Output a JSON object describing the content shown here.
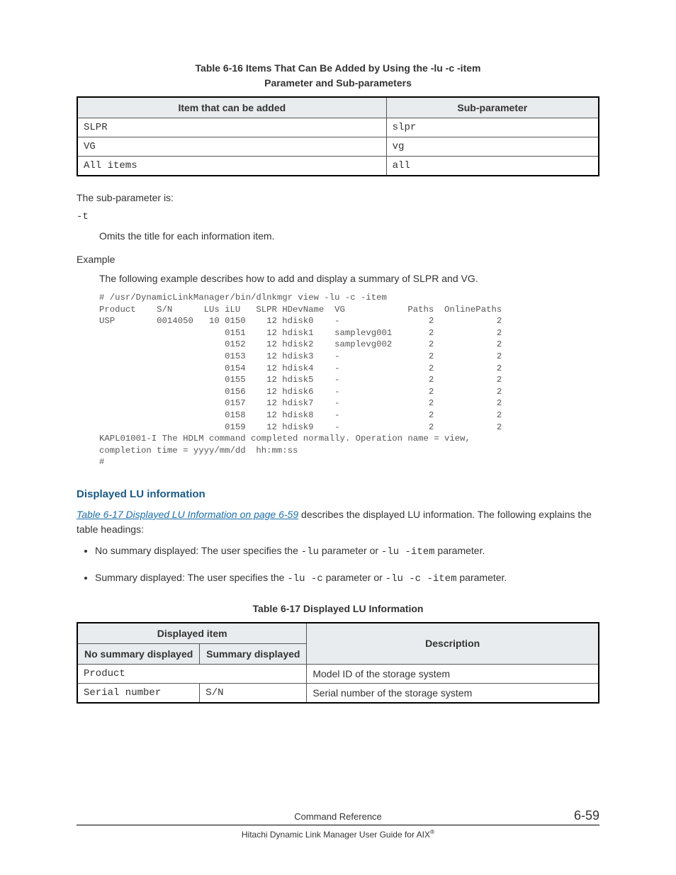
{
  "table616": {
    "caption_line1": "Table 6-16 Items That Can Be Added by Using the -lu -c -item",
    "caption_line2": "Parameter and Sub-parameters",
    "headers": {
      "c1": "Item that can be added",
      "c2": "Sub-parameter"
    },
    "rows": [
      {
        "c1": "SLPR",
        "c2": "slpr"
      },
      {
        "c1": "VG",
        "c2": "vg"
      },
      {
        "c1": "All items",
        "c2": "all"
      }
    ]
  },
  "subparam_intro": "The sub-parameter is:",
  "subparam_flag": "-t",
  "subparam_desc": "Omits the title for each information item.",
  "example": {
    "label": "Example",
    "desc": "The following example describes how to add and display a summary of SLPR and VG.",
    "lines": [
      "# /usr/DynamicLinkManager/bin/dlnkmgr view -lu -c -item",
      "Product    S/N      LUs iLU   SLPR HDevName  VG            Paths  OnlinePaths",
      "USP        0014050   10 0150    12 hdisk0    -                 2            2",
      "                        0151    12 hdisk1    samplevg001       2            2",
      "                        0152    12 hdisk2    samplevg002       2            2",
      "                        0153    12 hdisk3    -                 2            2",
      "                        0154    12 hdisk4    -                 2            2",
      "                        0155    12 hdisk5    -                 2            2",
      "                        0156    12 hdisk6    -                 2            2",
      "                        0157    12 hdisk7    -                 2            2",
      "                        0158    12 hdisk8    -                 2            2",
      "                        0159    12 hdisk9    -                 2            2",
      "KAPL01001-I The HDLM command completed normally. Operation name = view,",
      "completion time = yyyy/mm/dd  hh:mm:ss",
      "#"
    ]
  },
  "section": {
    "heading": "Displayed LU information",
    "link_text": "Table 6-17 Displayed LU Information on page 6-59",
    "body_after_link": " describes the displayed LU information. The following explains the table headings:",
    "bullets": [
      {
        "prefix": "No summary displayed: The user specifies the ",
        "code1": "-lu",
        "mid": " parameter or ",
        "code2": "-lu -item",
        "suffix": " parameter."
      },
      {
        "prefix": "Summary displayed: The user specifies the ",
        "code1": "-lu -c",
        "mid": " parameter or ",
        "code2": "-lu -c -item",
        "suffix": " parameter."
      }
    ]
  },
  "table617": {
    "caption": "Table 6-17 Displayed LU Information",
    "headers": {
      "group": "Displayed item",
      "c1": "No summary displayed",
      "c2": "Summary displayed",
      "c3": "Description"
    },
    "rows": [
      {
        "c1": "Product",
        "c1_colspan": 2,
        "c2": "",
        "c3": "Model ID of the storage system"
      },
      {
        "c1": "Serial number",
        "c1_colspan": 1,
        "c2": "S/N",
        "c3": "Serial number of the storage system"
      }
    ]
  },
  "footer": {
    "section": "Command Reference",
    "guide_prefix": "Hitachi Dynamic Link Manager User Guide for AIX",
    "reg": "®",
    "page": "6-59"
  }
}
